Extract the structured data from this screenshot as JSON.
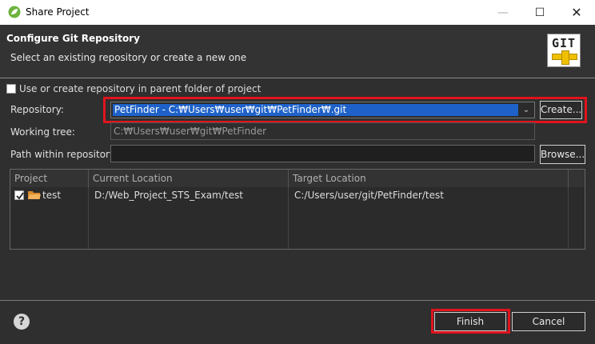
{
  "window": {
    "title": "Share Project"
  },
  "header": {
    "title": "Configure Git Repository",
    "subtitle": "Select an existing repository or create a new one",
    "logo_text": "GIT"
  },
  "parent_folder_checkbox": {
    "label": "Use or create repository in parent folder of project",
    "checked": false
  },
  "repository": {
    "label": "Repository:",
    "selected": "PetFinder - C:₩Users₩user₩git₩PetFinder₩.git",
    "create_label": "Create..."
  },
  "working_tree": {
    "label": "Working tree:",
    "value": "C:₩Users₩user₩git₩PetFinder"
  },
  "path_within": {
    "label": "Path within repository:",
    "value": "",
    "browse_label": "Browse..."
  },
  "table": {
    "headers": [
      "Project",
      "Current Location",
      "Target Location"
    ],
    "rows": [
      {
        "checked": true,
        "project": "test",
        "current": "D:/Web_Project_STS_Exam/test",
        "target": "C:/Users/user/git/PetFinder/test"
      }
    ]
  },
  "footer": {
    "finish_label": "Finish",
    "cancel_label": "Cancel"
  },
  "colors": {
    "highlight": "#e0141e",
    "selection": "#1e62c9"
  }
}
